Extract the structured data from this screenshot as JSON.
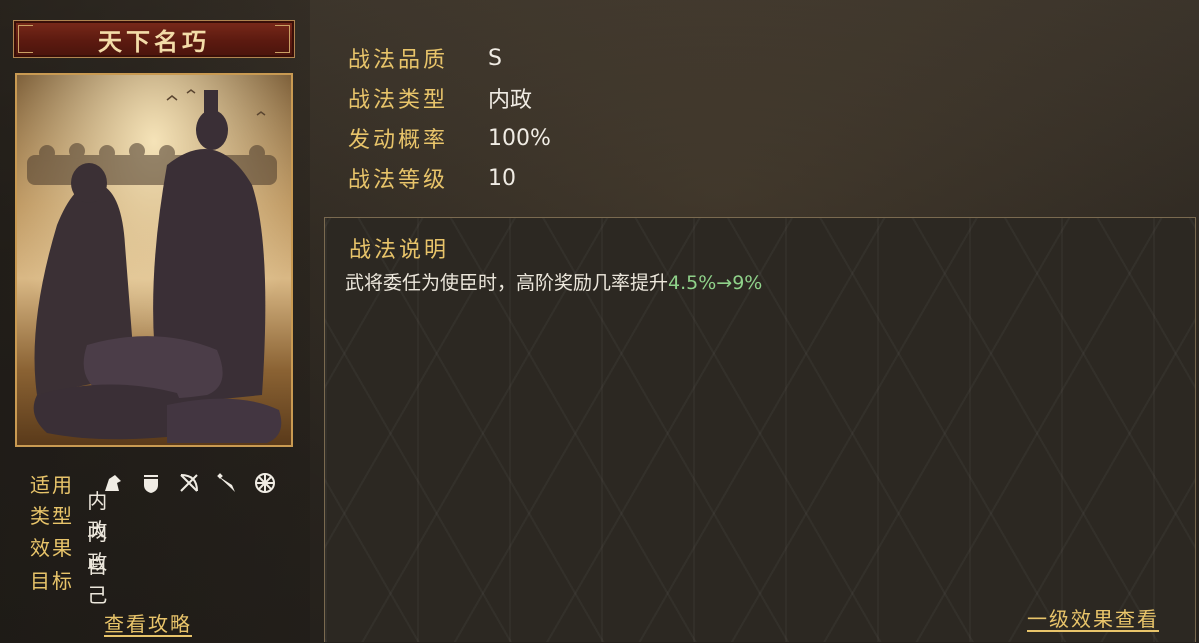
{
  "skill": {
    "name": "天下名巧"
  },
  "card_image": {
    "description_icon": "illustration-two-officials-with-sacks"
  },
  "meta": {
    "applicable_label": "适用",
    "applicable_icons": [
      "cavalry-icon",
      "shield-icon",
      "bow-icon",
      "spear-icon",
      "wheel-icon"
    ],
    "type_label": "类型",
    "type_value": "内政",
    "effect_label": "效果",
    "effect_value": "内政",
    "target_label": "目标",
    "target_value": "自己"
  },
  "left_link": "查看攻略",
  "info": {
    "quality_label": "战法品质",
    "quality_value": "S",
    "category_label": "战法类型",
    "category_value": "内政",
    "rate_label": "发动概率",
    "rate_value": "100%",
    "level_label": "战法等级",
    "level_value": "10"
  },
  "description": {
    "title": "战法说明",
    "text": "武将委任为使臣时，高阶奖励几率提升",
    "highlight": "4.5%→9%"
  },
  "right_link": "一级效果查看",
  "colors": {
    "label_gold": "#e8c46a",
    "highlight_green": "#8fd28a",
    "title_red": "#5c1a10"
  }
}
